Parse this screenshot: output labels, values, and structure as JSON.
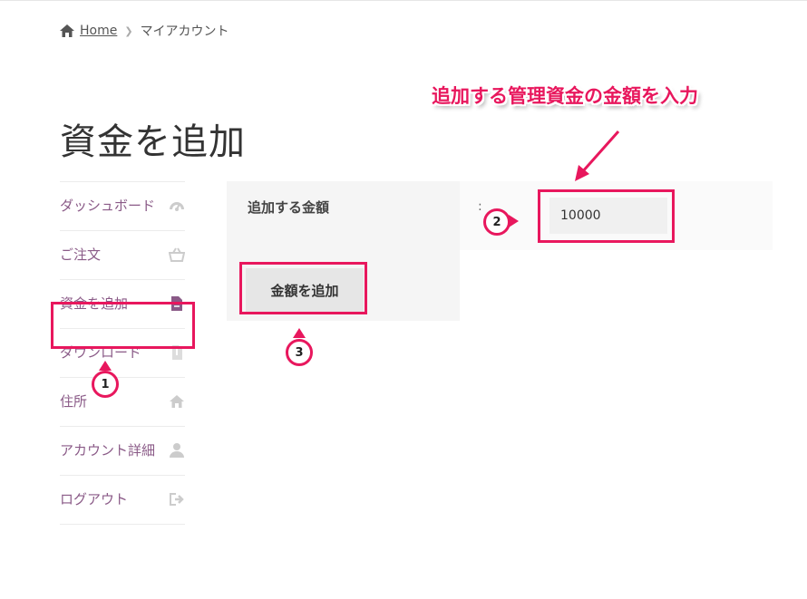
{
  "breadcrumb": {
    "home": "Home",
    "current": "マイアカウント"
  },
  "page_title": "資金を追加",
  "sidebar": {
    "items": [
      {
        "label": "ダッシュボード",
        "icon": "dashboard-icon"
      },
      {
        "label": "ご注文",
        "icon": "basket-icon"
      },
      {
        "label": "資金を追加",
        "icon": "document-icon"
      },
      {
        "label": "ダウンロード",
        "icon": "file-download-icon"
      },
      {
        "label": "住所",
        "icon": "home-icon"
      },
      {
        "label": "アカウント詳細",
        "icon": "user-icon"
      },
      {
        "label": "ログアウト",
        "icon": "logout-icon"
      }
    ]
  },
  "form": {
    "amount_label": "追加する金額",
    "colon": ":",
    "amount_value": "10000",
    "submit_label": "金額を追加"
  },
  "annotations": {
    "callout": "追加する管理資金の金額を入力",
    "step1": "1",
    "step2": "2",
    "step3": "3",
    "accent": "#e8175d"
  }
}
